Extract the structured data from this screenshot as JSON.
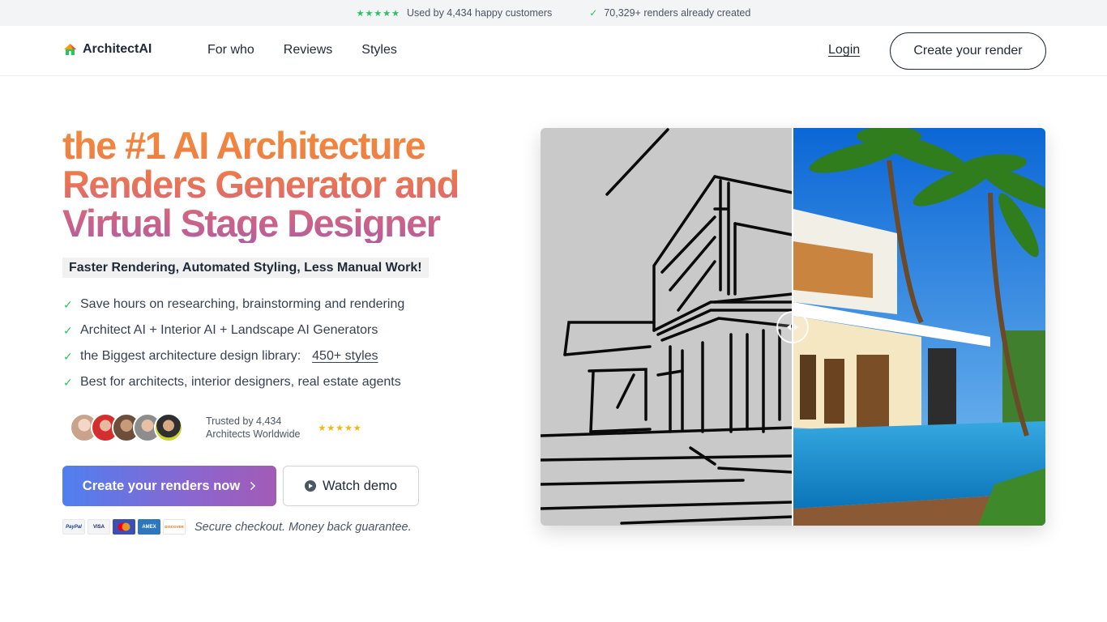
{
  "topbar": {
    "customers_text": "Used by 4,434 happy customers",
    "renders_text": "70,329+ renders already created"
  },
  "nav": {
    "brand": "ArchitectAI",
    "links": [
      "For who",
      "Reviews",
      "Styles"
    ],
    "login": "Login",
    "cta": "Create your render"
  },
  "hero": {
    "headline_lines": [
      "the #1 AI Architecture",
      "Renders Generator and",
      "Virtual Stage Designer"
    ],
    "subtag": "Faster Rendering, Automated Styling, Less Manual Work!",
    "features": [
      "Save hours on researching, brainstorming and rendering",
      "Architect AI + Interior AI + Landscape AI Generators",
      "the Biggest architecture design library:",
      "Best for architects, interior designers, real estate agents"
    ],
    "styles_link": "450+ styles",
    "trust_line1": "Trusted by 4,434",
    "trust_line2": "Architects Worldwide",
    "primary_button": "Create your renders now",
    "secondary_button": "Watch demo",
    "payment_cards": [
      "PayPal",
      "VISA",
      "MC",
      "AMEX",
      "DISCOVER"
    ],
    "secure_text": "Secure checkout. Money back guarantee."
  },
  "colors": {
    "accent_green": "#22c55e",
    "gold": "#f5b50a",
    "headline_gradient": [
      "#f28b3a",
      "#b25ea0"
    ],
    "button_gradient": [
      "#4f7ff0",
      "#a35bb5"
    ]
  },
  "compare": {
    "slider_percent": 50
  }
}
